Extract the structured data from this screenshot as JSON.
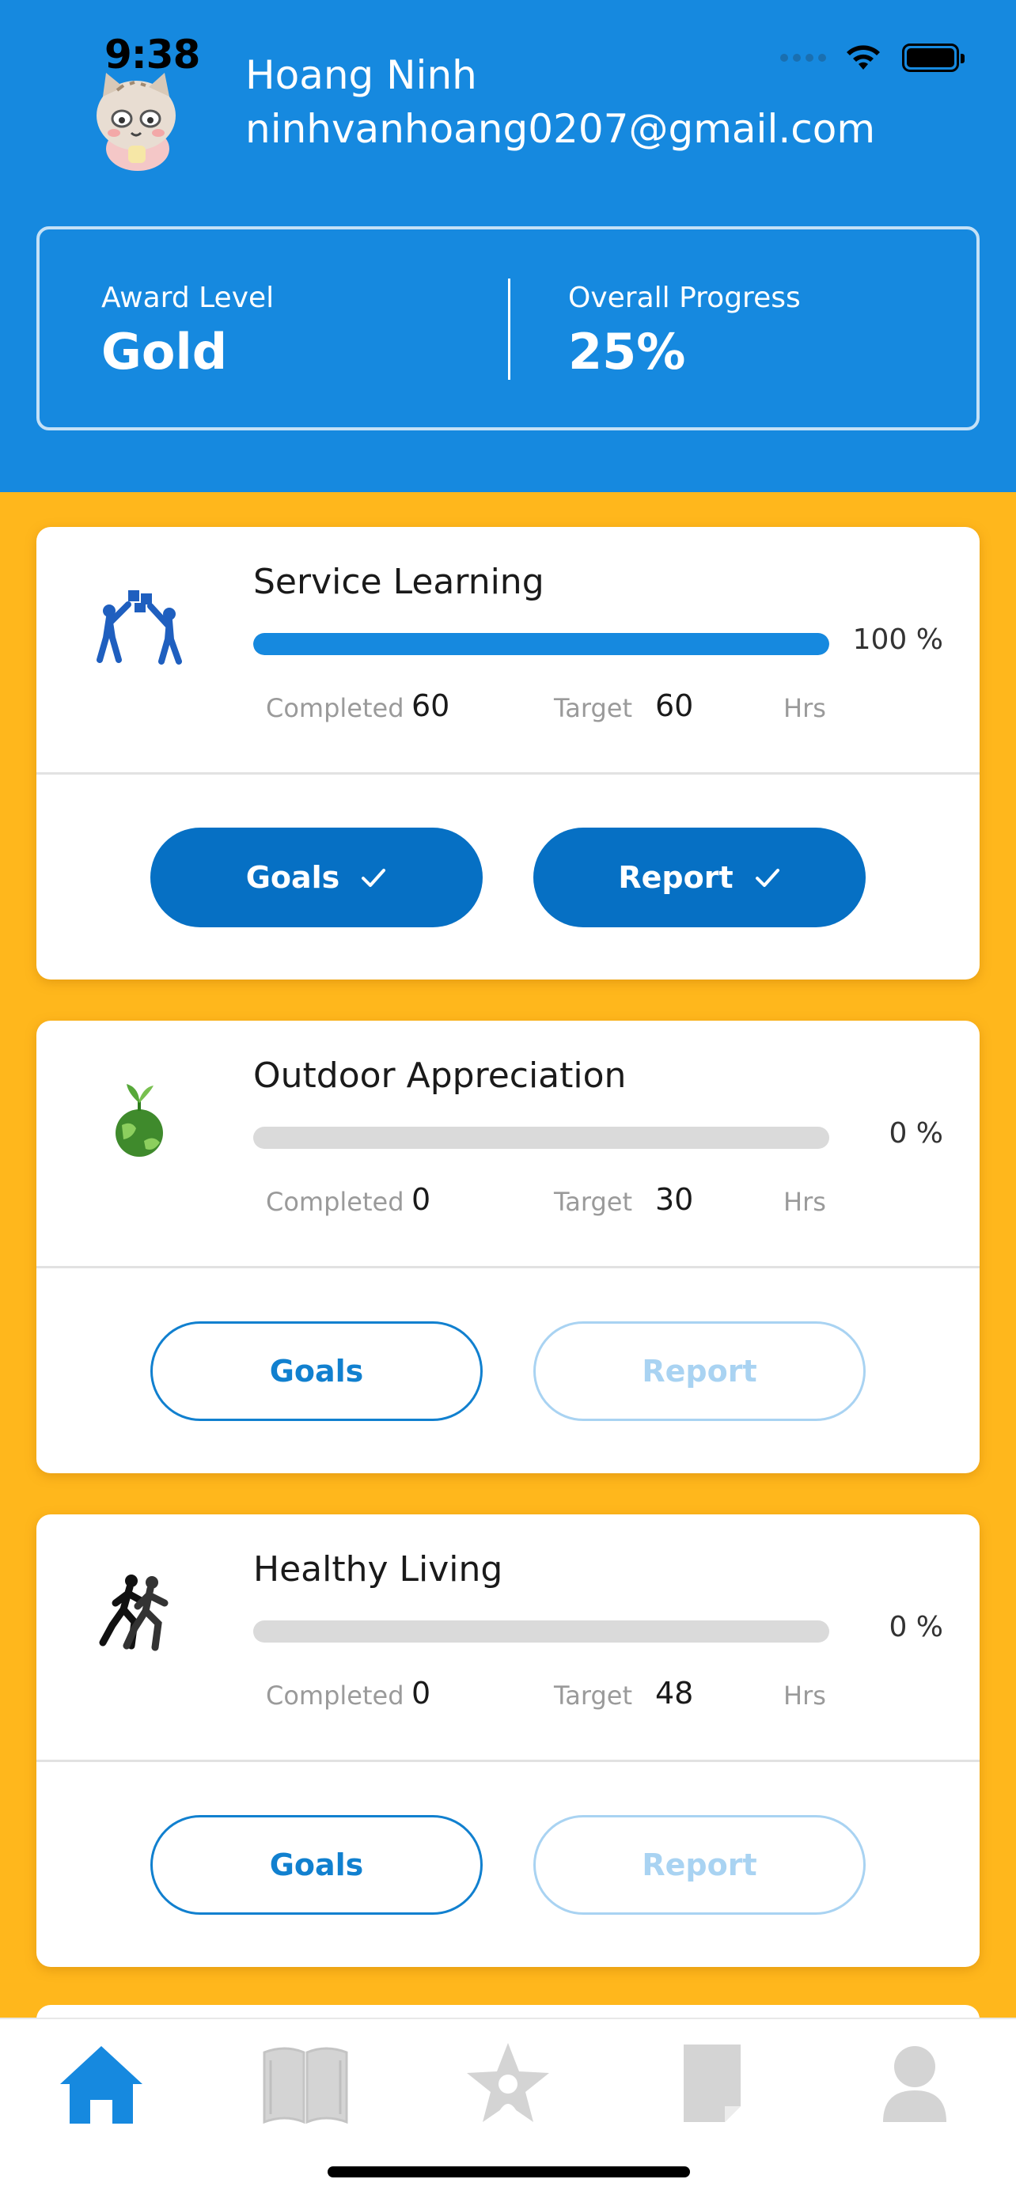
{
  "status_bar": {
    "time": "9:38"
  },
  "profile": {
    "name": "Hoang Ninh",
    "email": "ninhvanhoang0207@gmail.com",
    "award_label": "Award Level",
    "award_value": "Gold",
    "progress_label": "Overall Progress",
    "progress_value": "25%"
  },
  "cards": [
    {
      "title": "Service Learning",
      "icon": "teamwork-puzzle-icon",
      "progress_pct": 100,
      "progress_text": "100 %",
      "completed_label": "Completed",
      "completed": "60",
      "target_label": "Target",
      "target": "60",
      "unit": "Hrs",
      "goals_label": "Goals",
      "report_label": "Report",
      "goals_done": true,
      "report_done": true
    },
    {
      "title": "Outdoor Appreciation",
      "icon": "earth-plant-icon",
      "progress_pct": 0,
      "progress_text": "0 %",
      "completed_label": "Completed",
      "completed": "0",
      "target_label": "Target",
      "target": "30",
      "unit": "Hrs",
      "goals_label": "Goals",
      "report_label": "Report",
      "goals_done": false,
      "report_done": false
    },
    {
      "title": "Healthy Living",
      "icon": "runners-icon",
      "progress_pct": 0,
      "progress_text": "0 %",
      "completed_label": "Completed",
      "completed": "0",
      "target_label": "Target",
      "target": "48",
      "unit": "Hrs",
      "goals_label": "Goals",
      "report_label": "Report",
      "goals_done": false,
      "report_done": false
    }
  ],
  "tabbar": {
    "items": [
      "home-icon",
      "book-icon",
      "award-star-icon",
      "document-icon",
      "profile-icon"
    ],
    "active": "home-icon"
  },
  "colors": {
    "header_blue": "#1689DF",
    "background_yellow": "#FFB71C",
    "button_blue": "#0670C4",
    "disabled_blue": "#A9D3F2"
  }
}
